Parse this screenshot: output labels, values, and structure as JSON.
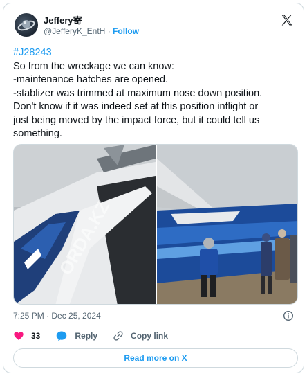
{
  "author": {
    "display_name": "Jeffery寄",
    "handle": "@JefferyK_EntH",
    "separator": "·",
    "follow_label": "Follow"
  },
  "tweet": {
    "hashtag": "#J28243",
    "lines": [
      "So from the wreckage we can know:",
      "-maintenance hatches are opened.",
      "-stablizer was trimmed at maximum nose down position.",
      "Don't know  if it was indeed set at this position inflight or",
      "just being moved by the impact force, but it could tell us",
      "something."
    ]
  },
  "media": {
    "watermark": "ORDA.KZ"
  },
  "footer": {
    "timestamp": "7:25 PM · Dec 25, 2024",
    "like_count": "33",
    "reply_label": "Reply",
    "copy_link_label": "Copy link",
    "read_more_label": "Read more on X"
  },
  "colors": {
    "accent": "#1d9bf0",
    "like": "#f91880",
    "muted": "#536471",
    "border": "#cfd9de"
  },
  "icons": [
    "x-logo-icon",
    "info-icon",
    "heart-icon",
    "reply-bubble-icon",
    "link-icon"
  ]
}
